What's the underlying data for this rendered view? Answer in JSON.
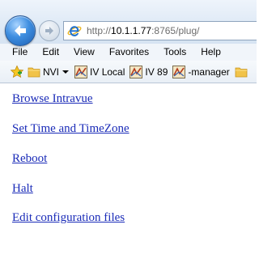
{
  "navigation": {
    "back_icon": "back-arrow-icon",
    "forward_icon": "forward-arrow-icon",
    "address": {
      "prefix": "http://",
      "host": "10.1.1.77",
      "suffix": ":8765/plug/"
    }
  },
  "menu": {
    "items": [
      {
        "label": "File"
      },
      {
        "label": "Edit"
      },
      {
        "label": "View"
      },
      {
        "label": "Favorites"
      },
      {
        "label": "Tools"
      },
      {
        "label": "Help"
      }
    ]
  },
  "favorites_bar": {
    "star_icon": "favorites-star-icon",
    "items": [
      {
        "label": "NVI",
        "icon": "folder-icon",
        "has_dropdown": true
      },
      {
        "label": "IV Local",
        "icon": "intravue-icon"
      },
      {
        "label": "IV 89",
        "icon": "intravue-icon"
      },
      {
        "label": "-manager",
        "icon": "intravue-icon"
      },
      {
        "label": "",
        "icon": "folder-icon"
      }
    ]
  },
  "page": {
    "links": [
      {
        "label": "Browse Intravue"
      },
      {
        "label": "Set Time and TimeZone"
      },
      {
        "label": "Reboot"
      },
      {
        "label": "Halt"
      },
      {
        "label": "Edit configuration files"
      }
    ]
  },
  "colors": {
    "link": "#1a2bb8",
    "chrome_light": "#eef4fb",
    "chrome_dark": "#d6e3f2"
  }
}
